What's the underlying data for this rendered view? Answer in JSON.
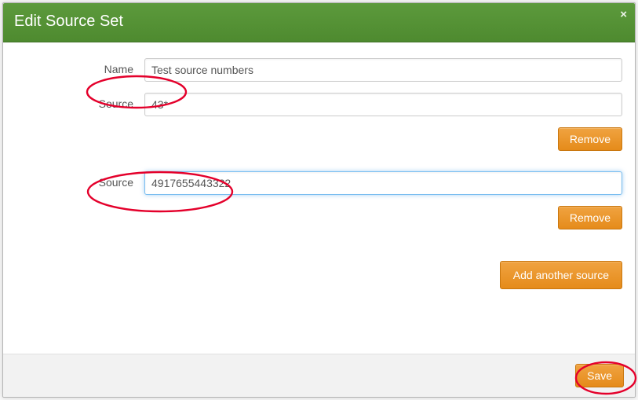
{
  "dialog": {
    "title": "Edit Source Set"
  },
  "fields": {
    "name_label": "Name",
    "name_value": "Test source numbers"
  },
  "sources": [
    {
      "label": "Source",
      "value": "43*",
      "remove_label": "Remove"
    },
    {
      "label": "Source",
      "value": "4917655443322",
      "remove_label": "Remove"
    }
  ],
  "actions": {
    "add_another": "Add another source",
    "save": "Save"
  }
}
